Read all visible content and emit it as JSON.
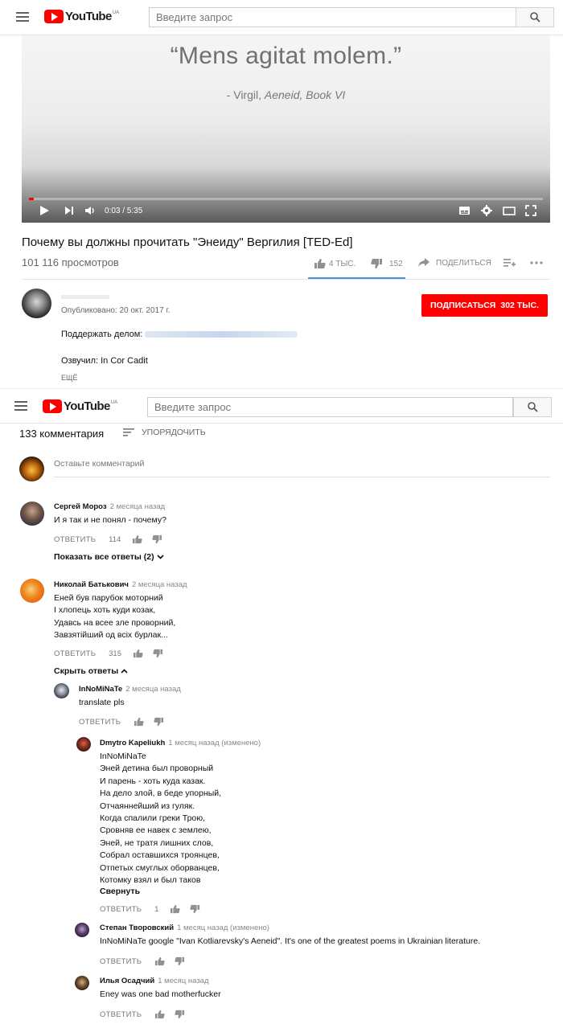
{
  "header": {
    "logo_text": "YouTube",
    "logo_region": "UA",
    "search_placeholder": "Введите запрос"
  },
  "player": {
    "quote": "“Mens agitat molem.”",
    "cite_prefix": "- Virgil, ",
    "cite_work": "Aeneid, Book VI",
    "time": "0:03 / 5:35",
    "progress": 0.01
  },
  "video": {
    "title": "Почему вы должны прочитать \"Энеиду\" Вергилия [TED-Ed]",
    "views": "101 116 просмотров",
    "likes": "4 ТЫС.",
    "dislikes": "152",
    "share": "ПОДЕЛИТЬСЯ"
  },
  "channel": {
    "published": "Опубликовано: 20 окт. 2017 г.",
    "subscribe_label": "ПОДПИСАТЬСЯ",
    "subscribers": "302 ТЫС.",
    "support": "Поддержать делом:",
    "voiced": "Озвучил: In Cor Cadit",
    "more": "ЕЩЁ"
  },
  "comments": {
    "count": "133 комментария",
    "sort": "УПОРЯДОЧИТЬ",
    "input_placeholder": "Оставьте комментарий",
    "reply_label": "ОТВЕТИТЬ",
    "items": [
      {
        "author": "Сергей Мороз",
        "when": "2 месяца назад",
        "text": "И я так и не понял - почему?",
        "likes": "114",
        "toggle": "Показать все ответы (2)"
      },
      {
        "author": "Николай Батькович",
        "when": "2 месяца назад",
        "text": "Еней був парубок моторний\nІ хлопець хоть куди козак,\nУдавсь на всее зле проворний,\nЗавзятійший од всіх бурлак...",
        "likes": "315",
        "toggle": "Скрыть ответы"
      }
    ],
    "replies": [
      {
        "author": "InNoMiNaTe",
        "when": "2 месяца назад",
        "text": "translate pls",
        "likes": ""
      },
      {
        "author": "Dmytro Kapeliukh",
        "when": "1 месяц назад (изменено)",
        "text": "InNoMiNaTe\nЭней детина был проворный\nИ парень - хоть куда казак.\nНа дело злой, в беде упорный,\nОтчаяннейший из гуляк.\nКогда спалили греки Трою,\nСровняв ее навек с землею,\nЭней, не тратя лишних слов,\nСобрал оставшихся троянцев,\nОтпетых смуглых оборванцев,\nКотомку взял и был таков",
        "collapse": "Свернуть",
        "likes": "1"
      },
      {
        "author": "Степан Творовский",
        "when": "1 месяц назад (изменено)",
        "text": "InNoMiNaTe google \"Ivan Kotliarevsky's Aeneid\". It's one of the greatest poems in Ukrainian literature.",
        "likes": ""
      },
      {
        "author": "Илья Осадчий",
        "when": "1 месяц назад",
        "text": "Eney was one bad motherfucker",
        "likes": ""
      }
    ]
  },
  "colors": {
    "brand_red": "#ff0000",
    "link_blue": "#4a90e2"
  }
}
